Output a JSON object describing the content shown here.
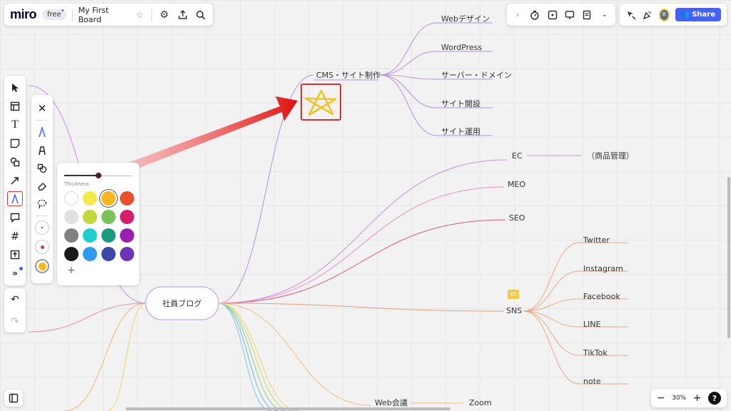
{
  "topbar": {
    "logo": "miro",
    "plan_badge": "free",
    "board_title": "My First Board",
    "share_label": "Share",
    "avatar_initial": "R"
  },
  "mindmap": {
    "root": "社員ブログ",
    "cms": {
      "label": "CMS・サイト制作",
      "children": [
        "Webデザイン",
        "WordPress",
        "サーバー・ドメイン",
        "サイト開設",
        "サイト運用"
      ]
    },
    "ec": {
      "label": "EC",
      "child": "（商品管理）"
    },
    "meo": "MEO",
    "seo": "SEO",
    "sns": {
      "label": "SNS",
      "children": [
        "Twitter",
        "Instagram",
        "Facebook",
        "LINE",
        "TikTok",
        "note"
      ]
    },
    "web_meeting": {
      "label": "Web会議",
      "child": "Zoom"
    }
  },
  "pen_panel": {
    "thickness_label": "Thickness",
    "thickness_value": 0.5,
    "colors": [
      "#ffffff",
      "#f5e94a",
      "#f5b91f",
      "#e8502e",
      "#e0e0e0",
      "#c3d83a",
      "#7ac25a",
      "#d41f6f",
      "#808080",
      "#1fcfd0",
      "#1a9a7e",
      "#9a1fb0",
      "#1a1a1a",
      "#2d9bf0",
      "#3e48a8",
      "#6c35b8"
    ],
    "selected_color_index": 2,
    "add_label": "+"
  },
  "zoom": {
    "level": "30%",
    "minus": "−",
    "plus": "+",
    "help": "?"
  },
  "icons": {
    "select": "arrow-cursor-icon",
    "templates": "templates-icon",
    "text": "text-icon",
    "sticky": "sticky-note-icon",
    "shapes": "shapes-icon",
    "connector": "connector-arrow-icon",
    "pen": "pen-icon",
    "comment": "comment-icon",
    "frame": "frame-icon",
    "upload": "upload-icon",
    "more": "more-tools-icon",
    "undo": "undo-icon",
    "redo": "redo-icon"
  },
  "accent": {
    "brand": "#4262ff",
    "highlight": "#d33333",
    "star": "#f2c21f"
  }
}
